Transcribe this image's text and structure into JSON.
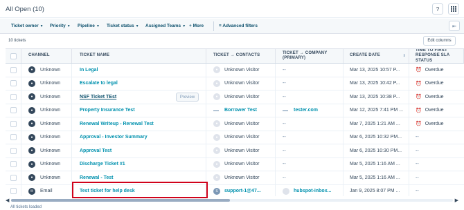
{
  "view": {
    "title": "All Open (10)",
    "help_icon": "?",
    "apps_icon": "grid-icon"
  },
  "filters": {
    "items": [
      "Ticket owner",
      "Priority",
      "Pipeline",
      "Ticket status",
      "Assigned Teams",
      "+ More"
    ],
    "advanced": "Advanced filters"
  },
  "summary": {
    "count": "10 tickets",
    "edit_columns": "Edit columns",
    "status": "All tickets loaded"
  },
  "columns": [
    "CHANNEL",
    "TICKET NAME",
    "TICKET → CONTACTS",
    "TICKET → COMPANY (PRIMARY)",
    "CREATE DATE",
    "TIME TO FIRST RESPONSE SLA STATUS"
  ],
  "rows": [
    {
      "channel": "Unknown",
      "name": "In Legal",
      "contact": "Unknown Visitor",
      "company": "--",
      "date": "Mar 13, 2025 10:57 P...",
      "sla": "Overdue"
    },
    {
      "channel": "Unknown",
      "name": "Escalate to legal",
      "contact": "Unknown Visitor",
      "company": "--",
      "date": "Mar 13, 2025 10:42 P...",
      "sla": "Overdue"
    },
    {
      "channel": "Unknown",
      "name": "NSF Ticket TEst",
      "preview": "Preview",
      "contact": "Unknown Visitor",
      "company": "--",
      "date": "Mar 13, 2025 10:38 P...",
      "sla": "Overdue"
    },
    {
      "channel": "Unknown",
      "name": "Property Insurance Test",
      "contact": "Borrower Test",
      "company": "tester.com",
      "date": "Mar 12, 2025 7:41 PM ...",
      "sla": "Overdue"
    },
    {
      "channel": "Unknown",
      "name": "Renewal Writeup - Renewal Test",
      "contact": "Unknown Visitor",
      "company": "--",
      "date": "Mar 7, 2025 1:21 AM ...",
      "sla": "Overdue"
    },
    {
      "channel": "Unknown",
      "name": "Approval - Investor Summary",
      "contact": "Unknown Visitor",
      "company": "--",
      "date": "Mar 6, 2025 10:32 PM...",
      "sla": "--"
    },
    {
      "channel": "Unknown",
      "name": "Approval Test",
      "contact": "Unknown Visitor",
      "company": "--",
      "date": "Mar 6, 2025 10:30 PM...",
      "sla": "--"
    },
    {
      "channel": "Unknown",
      "name": "Discharge Ticket #1",
      "contact": "Unknown Visitor",
      "company": "--",
      "date": "Mar 5, 2025 1:16 AM ...",
      "sla": "--"
    },
    {
      "channel": "Unknown",
      "name": "Renewal - Test",
      "contact": "Unknown Visitor",
      "company": "--",
      "date": "Mar 5, 2025 1:16 AM ...",
      "sla": "--"
    },
    {
      "channel": "Email",
      "name": "Test ticket for help desk",
      "contact": "support-1@47...",
      "company": "hubspot-inbox...",
      "date": "Jan 9, 2025 8:07 PM ...",
      "sla": "--"
    }
  ]
}
